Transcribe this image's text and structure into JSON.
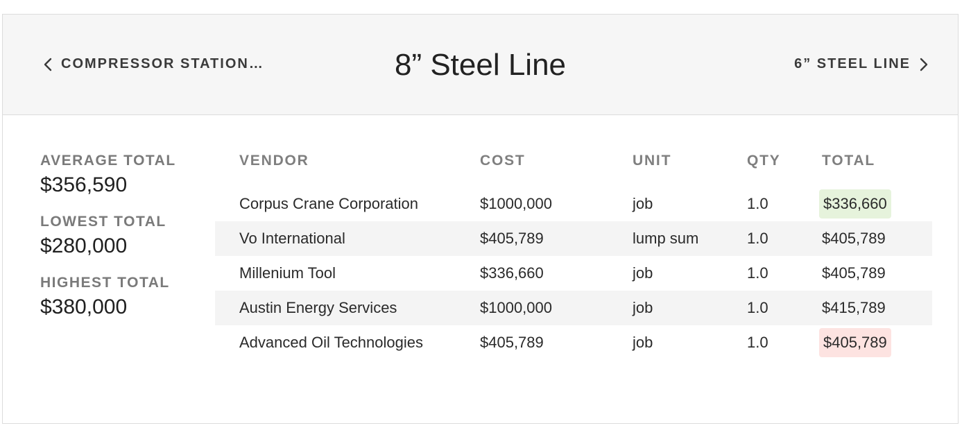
{
  "header": {
    "prev_label": "COMPRESSOR STATION…",
    "title": "8” Steel Line",
    "next_label": "6” STEEL LINE"
  },
  "stats": [
    {
      "label": "AVERAGE TOTAL",
      "value": "$356,590"
    },
    {
      "label": "LOWEST TOTAL",
      "value": "$280,000"
    },
    {
      "label": "HIGHEST TOTAL",
      "value": "$380,000"
    }
  ],
  "table": {
    "columns": [
      "VENDOR",
      "COST",
      "UNIT",
      "QTY",
      "TOTAL"
    ],
    "rows": [
      {
        "vendor": "Corpus Crane Corporation",
        "cost": "$1000,000",
        "unit": "job",
        "qty": "1.0",
        "total": "$336,660",
        "highlight": "lowest"
      },
      {
        "vendor": "Vo International",
        "cost": "$405,789",
        "unit": "lump sum",
        "qty": "1.0",
        "total": "$405,789",
        "highlight": ""
      },
      {
        "vendor": "Millenium Tool",
        "cost": "$336,660",
        "unit": "job",
        "qty": "1.0",
        "total": "$405,789",
        "highlight": ""
      },
      {
        "vendor": "Austin Energy Services",
        "cost": "$1000,000",
        "unit": "job",
        "qty": "1.0",
        "total": "$415,789",
        "highlight": ""
      },
      {
        "vendor": "Advanced Oil Technologies",
        "cost": "$405,789",
        "unit": "job",
        "qty": "1.0",
        "total": "$405,789",
        "highlight": "highest"
      }
    ]
  },
  "colors": {
    "lowest_highlight": "#e6f3dc",
    "highest_highlight": "#fde3e1",
    "header_bg": "#f6f6f6",
    "stripe_bg": "#f4f4f4"
  }
}
